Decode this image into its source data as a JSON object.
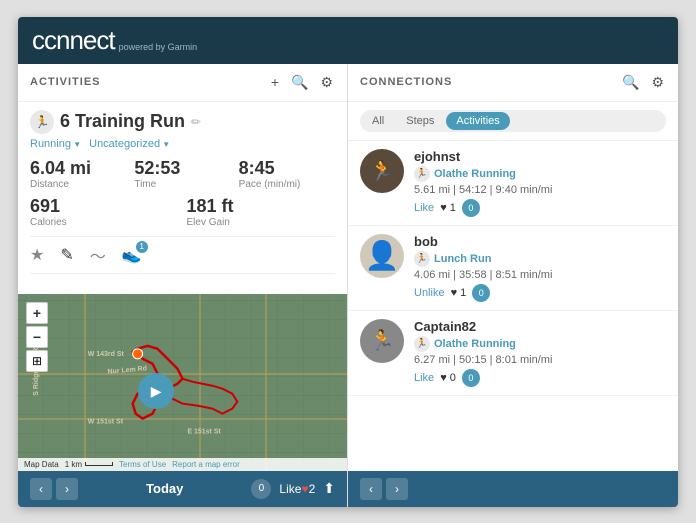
{
  "header": {
    "logo": "connect",
    "powered_by": "powered by Garmin"
  },
  "activities_panel": {
    "title": "ACTIVITIES",
    "actions": {
      "add": "+",
      "search": "🔍",
      "settings": "⚙"
    },
    "activity": {
      "icon": "🏃",
      "name": "6 Training Run",
      "edit_icon": "✏",
      "tags": [
        "Running",
        "Uncategorized"
      ],
      "stats": [
        {
          "value": "6.04 mi",
          "label": "Distance"
        },
        {
          "value": "52:53",
          "label": "Time"
        },
        {
          "value": "8:45",
          "label": "Pace (min/mi)"
        }
      ],
      "stats2": [
        {
          "value": "691",
          "label": "Calories"
        },
        {
          "value": "181 ft",
          "label": "Elev Gain"
        }
      ]
    },
    "nav_icons": [
      "★",
      "✏",
      "〜",
      "👟"
    ],
    "bottom_bar": {
      "today_label": "Today",
      "notification_count": "0",
      "like_count": "2",
      "like_label": "Like"
    }
  },
  "connections_panel": {
    "title": "CONNECTIONS",
    "filter_tabs": [
      "All",
      "Steps",
      "Activities"
    ],
    "active_tab": "Activities",
    "connections": [
      {
        "username": "ejohnst",
        "avatar_type": "avatar1",
        "avatar_icon": "🏃",
        "activity_name": "Olathe Running",
        "stats": "5.61 mi | 54:12 | 9:40 min/mi",
        "like_label": "Like",
        "like_count": "1",
        "comment_count": "0"
      },
      {
        "username": "bob",
        "avatar_type": "avatar2",
        "avatar_icon": "👤",
        "activity_name": "Lunch Run",
        "stats": "4.06 mi | 35:58 | 8:51 min/mi",
        "like_label": "Unlike",
        "like_count": "1",
        "comment_count": "0"
      },
      {
        "username": "Captain82",
        "avatar_type": "avatar3",
        "avatar_icon": "🏃",
        "activity_name": "Olathe Running",
        "stats": "6.27 mi | 50:15 | 8:01 min/mi",
        "like_label": "Like",
        "like_count": "0",
        "comment_count": "0"
      }
    ],
    "bottom_bar": {
      "prev": "‹",
      "next": "›"
    }
  },
  "map": {
    "labels": [
      "W 143rd St",
      "W 151st St",
      "E 151st St",
      "S Ridgeview Rd",
      "Nur Lem Rd"
    ],
    "footer": [
      "Map Data",
      "1 km",
      "Terms of Use",
      "Report a map error"
    ],
    "controls": [
      "+",
      "−"
    ]
  }
}
